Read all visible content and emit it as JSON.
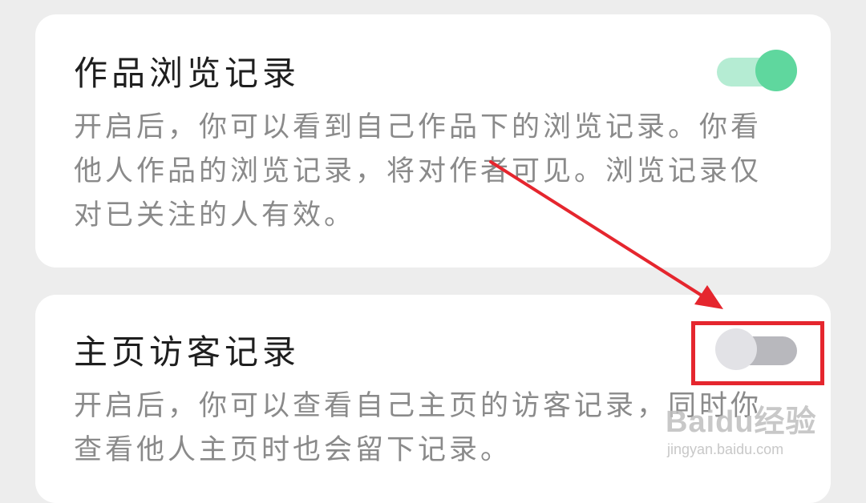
{
  "settings": [
    {
      "title": "作品浏览记录",
      "description": "开启后，你可以看到自己作品下的浏览记录。你看他人作品的浏览记录，将对作者可见。浏览记录仅对已关注的人有效。",
      "enabled": true
    },
    {
      "title": "主页访客记录",
      "description": "开启后，你可以查看自己主页的访客记录，同时你查看他人主页时也会留下记录。",
      "enabled": false
    }
  ],
  "watermark": {
    "logo": "Baidu经验",
    "url": "jingyan.baidu.com"
  },
  "colors": {
    "toggle_on_knob": "#5fd79e",
    "toggle_on_track": "#b5ecd3",
    "toggle_off_knob": "#e2e2e6",
    "toggle_off_track": "#b8b8bd",
    "annotation": "#e5262e"
  }
}
